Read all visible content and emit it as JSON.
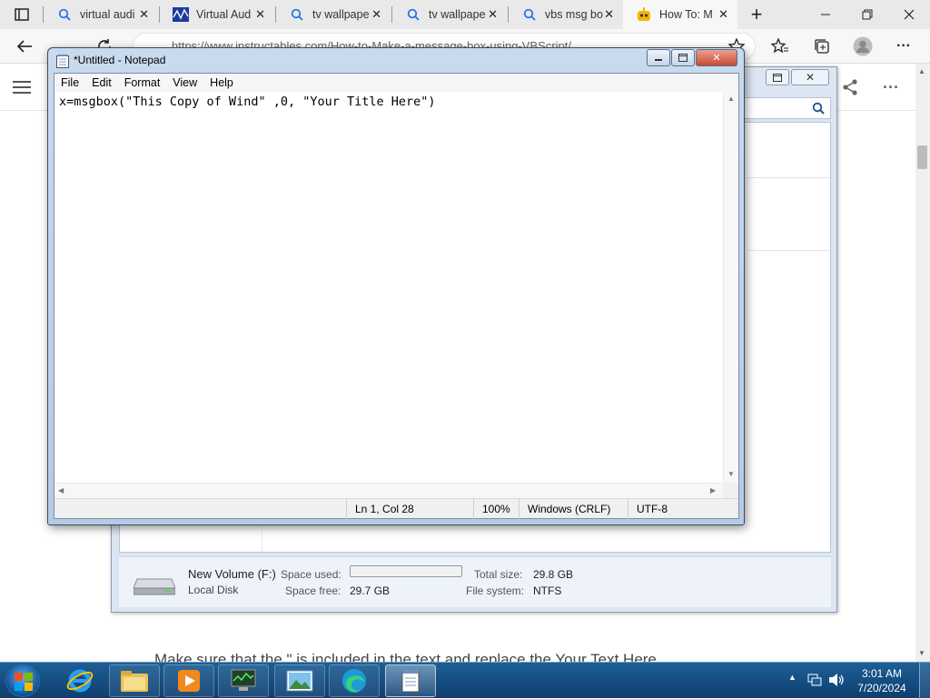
{
  "browser": {
    "tabs": [
      {
        "title": "virtual audi",
        "icon": "search-icon"
      },
      {
        "title": "Virtual Aud",
        "icon": "waveform-icon"
      },
      {
        "title": "tv wallpape",
        "icon": "search-icon"
      },
      {
        "title": "tv wallpape",
        "icon": "search-icon"
      },
      {
        "title": "vbs msg bo",
        "icon": "search-icon"
      },
      {
        "title": "How To: M",
        "icon": "robot-icon",
        "active": true
      }
    ],
    "url": "https://www.instructables.com/How-to-Make-a-message-box-using-VBScript/",
    "new_tab": "+"
  },
  "page": {
    "text": "Make sure that the \" is included in the text and replace the Your Text Here"
  },
  "explorer": {
    "drive_name": "New Volume (F:)",
    "drive_type": "Local Disk",
    "space_used_label": "Space used:",
    "space_free_label": "Space free:",
    "space_free": "29.7 GB",
    "total_size_label": "Total size:",
    "total_size": "29.8 GB",
    "file_system_label": "File system:",
    "file_system": "NTFS"
  },
  "notepad": {
    "title": "*Untitled - Notepad",
    "menu": [
      "File",
      "Edit",
      "Format",
      "View",
      "Help"
    ],
    "content": "x=msgbox(\"This Copy of Wind\" ,0, \"Your Title Here\")",
    "status": {
      "position": "Ln 1, Col 28",
      "zoom": "100%",
      "line_ending": "Windows (CRLF)",
      "encoding": "UTF-8"
    }
  },
  "taskbar": {
    "time": "3:01 AM",
    "date": "7/20/2024"
  },
  "colors": {
    "taskbar": "#1d5f96",
    "notepad_frame": "#c8daee",
    "close_button": "#c74a32"
  }
}
